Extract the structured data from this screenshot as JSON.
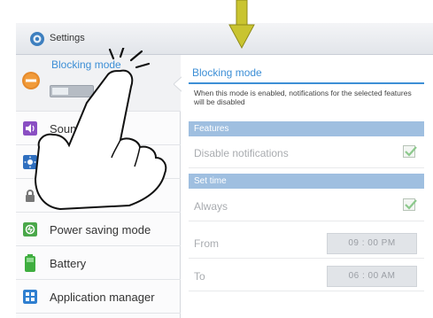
{
  "titlebar": {
    "title": "Settings",
    "icon": "gear-icon"
  },
  "left_panel": {
    "blocking_mode": {
      "label": "Blocking mode",
      "toggle_state": "off",
      "icon": "minus-circle-icon"
    },
    "items": [
      {
        "label": "Sound",
        "icon": "sound-icon",
        "color": "#8a4fc3"
      },
      {
        "label": "",
        "icon": "brightness-icon",
        "color": "#2f6fbf"
      },
      {
        "label": "",
        "icon": "lock-icon",
        "color": "#777777"
      },
      {
        "label": "Power saving mode",
        "icon": "power-saving-icon",
        "color": "#4aa84a"
      },
      {
        "label": "Battery",
        "icon": "battery-icon",
        "color": "#3fae3f"
      },
      {
        "label": "Application manager",
        "icon": "apps-grid-icon",
        "color": "#2f7fd0"
      }
    ]
  },
  "detail": {
    "header": "Blocking mode",
    "description": "When this mode is enabled, notifications for the selected features will be disabled",
    "features_header": "Features",
    "disable_notifications": {
      "label": "Disable notifications",
      "checked": true
    },
    "set_time_header": "Set time",
    "always": {
      "label": "Always",
      "checked": true
    },
    "from": {
      "label": "From",
      "value": "09 : 00 PM"
    },
    "to": {
      "label": "To",
      "value": "06 : 00 AM"
    }
  },
  "colors": {
    "accent": "#3d8fd6",
    "section_bar": "#9fbfe0",
    "arrow": "#c9c430"
  }
}
